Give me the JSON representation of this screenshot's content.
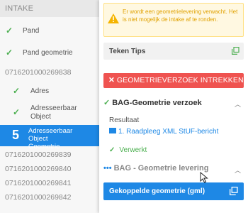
{
  "sidebar": {
    "header": "INTAKE",
    "items": [
      {
        "label": "Pand",
        "checked": true
      },
      {
        "label": "Pand geometrie",
        "checked": true
      }
    ],
    "group1_id": "071620100026983​8",
    "sub_items": [
      {
        "label": "Adres",
        "checked": true
      },
      {
        "label": "Adresseerbaar Object",
        "checked": true
      }
    ],
    "active": {
      "number": "5",
      "label": "Adresseerbaar Object Geometrie"
    },
    "ids": [
      "0716201000269839",
      "0716201000269840",
      "0716201000269841",
      "0716201000269842"
    ]
  },
  "panel": {
    "warning": "Er wordt een geometrielevering verwacht. Het is niet mogelijk de intake af te ronden.",
    "tips_label": "Teken Tips",
    "revoke_button": "GEOMETRIEVERZOEK INTREKKEN",
    "section1_title": "BAG-Geometrie verzoek",
    "result_label": "Resultaat",
    "result_link": "1. Raadpleeg XML StUF-bericht",
    "status": "Verwerkt",
    "section2_title": "BAG - Geometrie levering",
    "linked_button": "Gekoppelde geometrie (gml)"
  },
  "colors": {
    "accent": "#1e88e5",
    "success": "#4caf50",
    "danger": "#ef5350",
    "warning": "#e0a100"
  }
}
